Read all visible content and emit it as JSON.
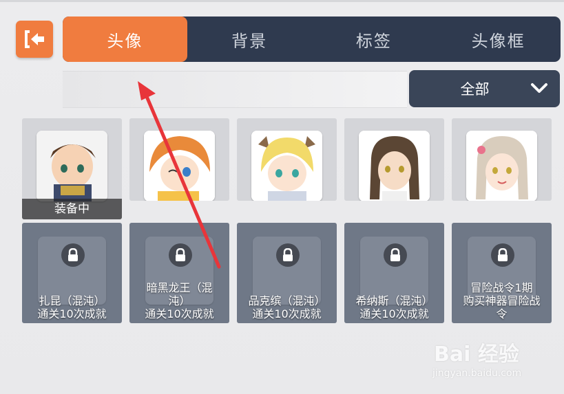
{
  "header": {
    "back_icon": "exit-back-icon",
    "tabs": [
      {
        "label": "头像",
        "active": true
      },
      {
        "label": "背景",
        "active": false
      },
      {
        "label": "标签",
        "active": false
      },
      {
        "label": "头像框",
        "active": false
      }
    ]
  },
  "filter": {
    "selected": "全部",
    "icon": "chevron-down-icon"
  },
  "avatars": [
    {
      "name": "armored-warrior",
      "status": "装备中",
      "locked": false
    },
    {
      "name": "orange-hair-girl",
      "locked": false
    },
    {
      "name": "blonde-horned-hero",
      "locked": false
    },
    {
      "name": "long-hair-man",
      "locked": false
    },
    {
      "name": "flower-hair-girl",
      "locked": false
    },
    {
      "name": "扎昆",
      "condition": "扎昆（混沌）通关10次成就",
      "locked": true
    },
    {
      "name": "暗黑龙王",
      "condition": "暗黑龙王（混沌）通关10次成就",
      "locked": true
    },
    {
      "name": "品克缤",
      "condition": "品克缤（混沌）通关10次成就",
      "locked": true
    },
    {
      "name": "希纳斯",
      "condition": "希纳斯（混沌）通关10次成就",
      "locked": true
    },
    {
      "name": "冒险战令",
      "condition": "冒险战令1期购买神器冒险战令",
      "locked": true
    }
  ],
  "conditions": [
    [
      "扎昆（混沌）",
      "通关10次成就"
    ],
    [
      "暗黑龙王（混",
      "沌）",
      "通关10次成就"
    ],
    [
      "品克缤（混沌）",
      "通关10次成就"
    ],
    [
      "希纳斯（混沌）",
      "通关10次成就"
    ],
    [
      "冒险战令1期",
      "购买神器冒险战",
      "令"
    ]
  ],
  "colors": {
    "accent": "#f07c3f",
    "tabbar": "#2f3a4f",
    "annotation_arrow": "#e8353a"
  },
  "watermark": {
    "brand": "Bai 经验",
    "url": "jingyan.baidu.com"
  }
}
